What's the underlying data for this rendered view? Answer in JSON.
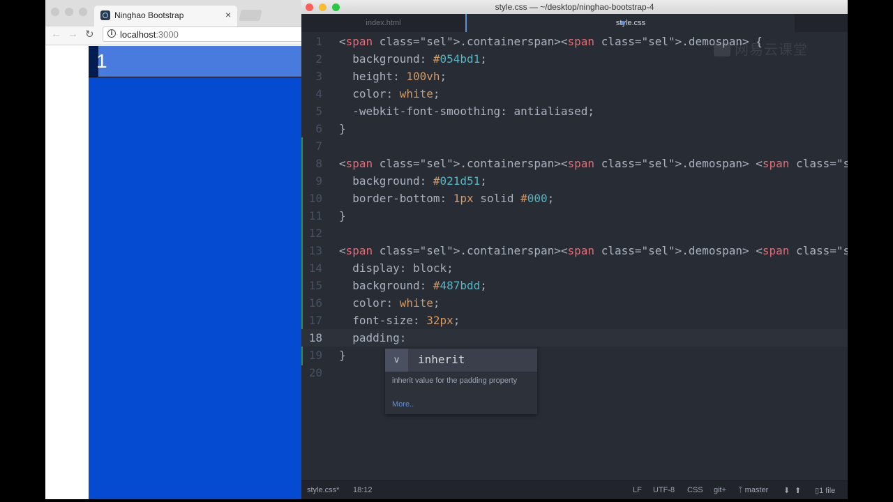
{
  "browser": {
    "tab_title": "Ninghao Bootstrap",
    "tab_close": "×",
    "url_host": "localhost",
    "url_port": ":3000",
    "nav_back": "←",
    "nav_forward": "→",
    "nav_reload": "↻",
    "info_icon": "i",
    "page_span_text": "1"
  },
  "editor": {
    "window_title": "style.css — ~/desktop/ninghao-bootstrap-4",
    "tabs": [
      {
        "label": "index.html",
        "active": false
      },
      {
        "label": "style.css",
        "active": true,
        "modified": true
      }
    ],
    "watermark": "网易云课堂",
    "current_line": 18,
    "code_lines": [
      ".container.demo {",
      "  background: #054bd1;",
      "  height: 100vh;",
      "  color: white;",
      "  -webkit-font-smoothing: antialiased;",
      "}",
      "",
      ".container.demo .row {",
      "  background: #021d51;",
      "  border-bottom: 1px solid #000;",
      "}",
      "",
      ".container.demo .row > div > span {",
      "  display: block;",
      "  background: #487bdd;",
      "  color: white;",
      "  font-size: 32px;",
      "  padding:",
      "}",
      ""
    ],
    "autocomplete": {
      "badge": "v",
      "suggestion": "inherit",
      "description": "inherit value for the padding property",
      "more": "More.."
    },
    "status": {
      "file": "style.css*",
      "cursor": "18:12",
      "line_ending": "LF",
      "encoding": "UTF-8",
      "grammar": "CSS",
      "git": "git+",
      "branch": "master",
      "files": "1 file"
    }
  },
  "colors": {
    "demo_bg": "#054bd1",
    "row_bg": "#021d51",
    "span_bg": "#487bdd",
    "editor_bg": "#282c34"
  }
}
